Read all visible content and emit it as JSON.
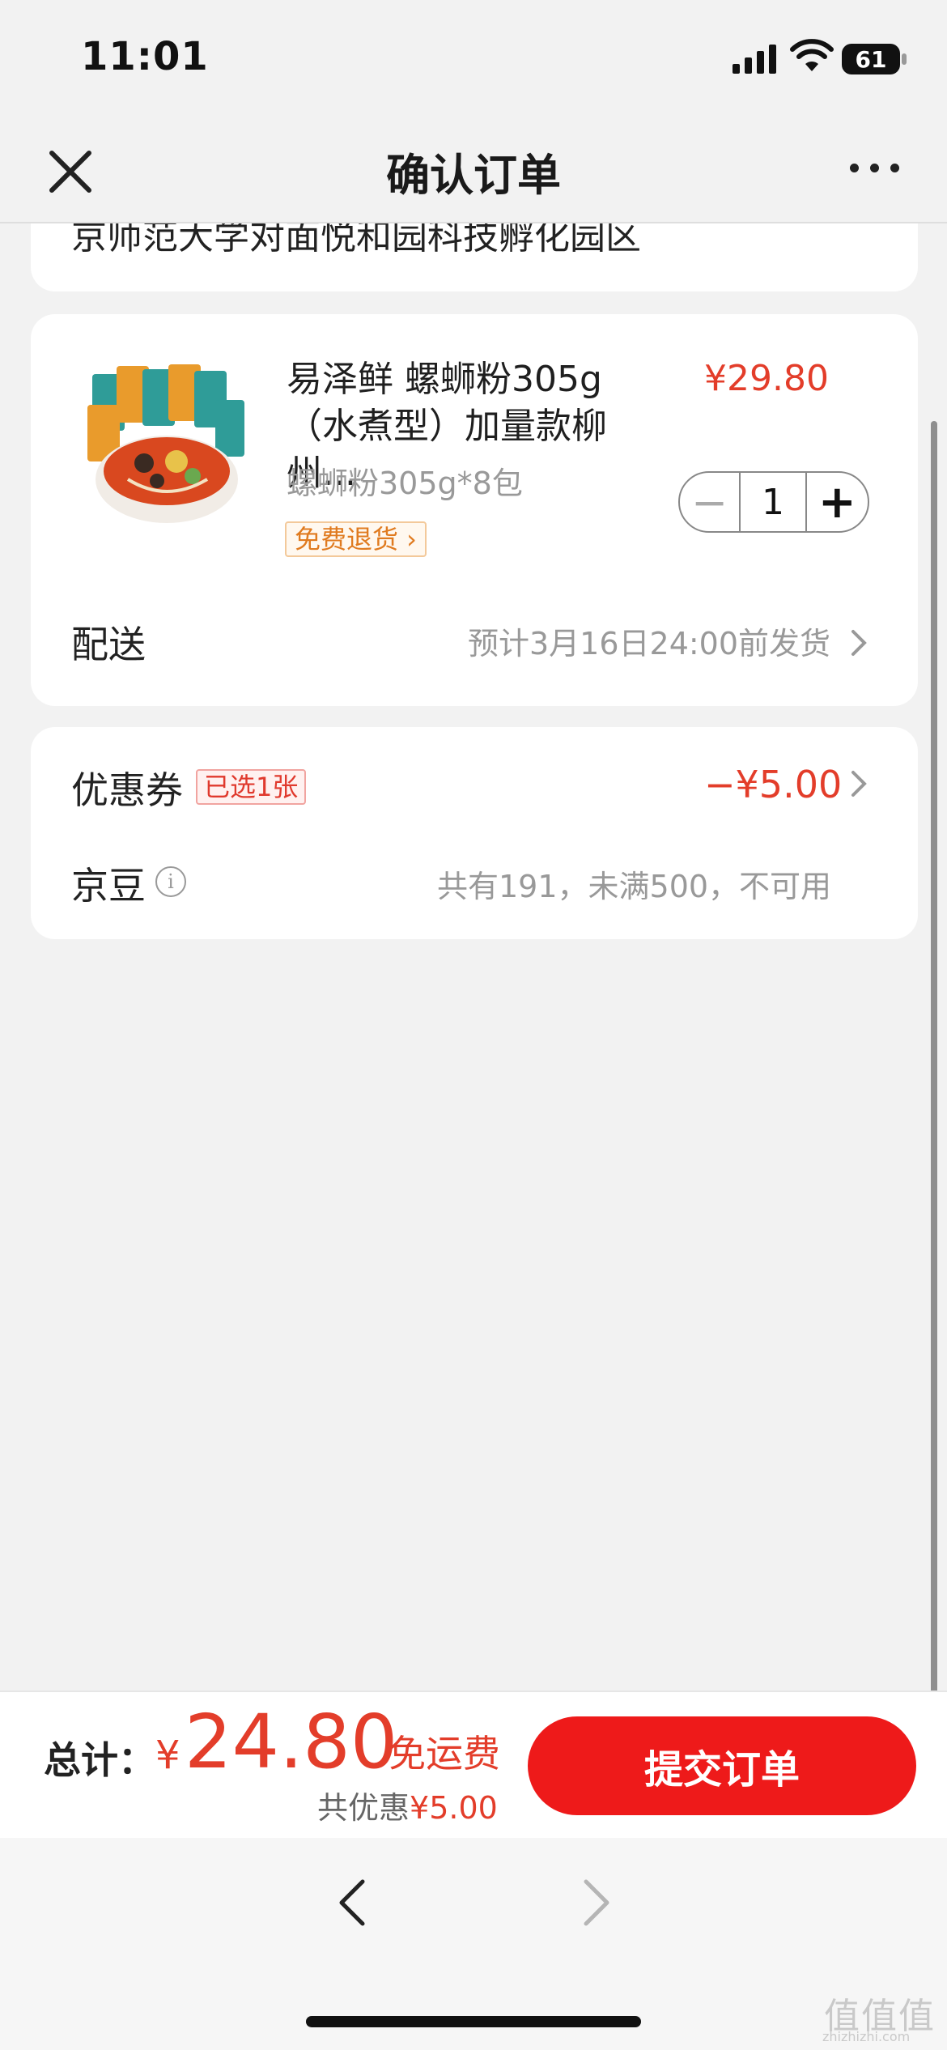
{
  "status_bar": {
    "time": "11:01",
    "battery": "61"
  },
  "nav": {
    "title": "确认订单"
  },
  "address": {
    "text": "京师范大学对面悦和园科技孵化园区"
  },
  "product": {
    "name": "易泽鲜 螺蛳粉305g（水煮型）加量款柳州...",
    "price": "¥29.80",
    "spec": "螺蛳粉305g*8包",
    "tag": "免费退货 ›",
    "quantity": "1",
    "minus": "−",
    "plus": "+"
  },
  "shipping": {
    "label": "配送",
    "value": "预计3月16日24:00前发货"
  },
  "coupon": {
    "label": "优惠券",
    "badge": "已选1张",
    "value": "−¥5.00"
  },
  "beans": {
    "label": "京豆",
    "info": "i",
    "value": "共有191，未满500，不可用"
  },
  "footer": {
    "total_label": "总计：",
    "currency": "¥",
    "total": "24.80",
    "free_shipping": "免运费",
    "saved_label": "共优惠",
    "saved_value": "¥5.00",
    "submit": "提交订单"
  },
  "watermark": {
    "mark": "值值值",
    "site": "zhizhizhi.com"
  },
  "colors": {
    "accent": "#e33d2a",
    "button": "#ee1a1a",
    "background": "#f2f2f2"
  }
}
